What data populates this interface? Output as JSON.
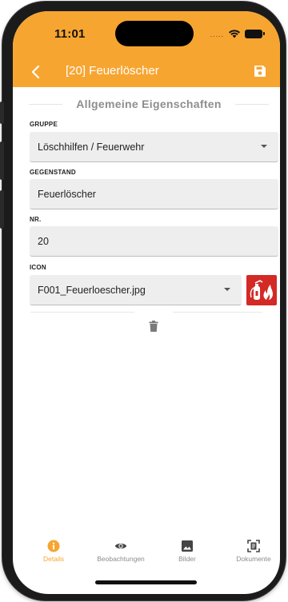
{
  "status_bar": {
    "time": "11:01",
    "dots": "....."
  },
  "appbar": {
    "title": "[20] Feuerlöscher"
  },
  "section": {
    "title": "Allgemeine Eigenschaften"
  },
  "fields": {
    "gruppe": {
      "label": "GRUPPE",
      "value": "Löschhilfen / Feuerwehr"
    },
    "gegenstand": {
      "label": "GEGENSTAND",
      "value": "Feuerlöscher"
    },
    "nr": {
      "label": "NR.",
      "value": "20"
    },
    "icon": {
      "label": "ICON",
      "value": "F001_Feuerloescher.jpg"
    }
  },
  "nav": {
    "items": [
      {
        "label": "Details",
        "icon": "info-icon",
        "active": true
      },
      {
        "label": "Beobachtungen",
        "icon": "eye-icon",
        "active": false
      },
      {
        "label": "Bilder",
        "icon": "image-icon",
        "active": false
      },
      {
        "label": "Dokumente",
        "icon": "document-scan-icon",
        "active": false
      }
    ]
  },
  "colors": {
    "accent": "#f7a531",
    "icon_preview_bg": "#d32a26",
    "field_bg": "#eeeeee"
  }
}
